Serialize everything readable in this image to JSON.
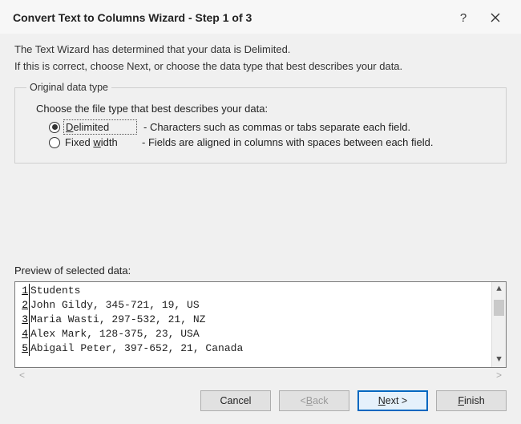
{
  "titlebar": {
    "title": "Convert Text to Columns Wizard - Step 1 of 3"
  },
  "intro": {
    "line1": "The Text Wizard has determined that your data is Delimited.",
    "line2": "If this is correct, choose Next, or choose the data type that best describes your data."
  },
  "group": {
    "legend": "Original data type",
    "prompt": "Choose the file type that best describes your data:",
    "options": {
      "delimited": {
        "pre": "",
        "accel": "D",
        "post": "elimited",
        "desc": "- Characters such as commas or tabs separate each field.",
        "selected": true
      },
      "fixed": {
        "pre": "Fixed ",
        "accel": "w",
        "post": "idth",
        "desc": "- Fields are aligned in columns with spaces between each field.",
        "selected": false
      }
    }
  },
  "preview": {
    "label": "Preview of selected data:",
    "rows": [
      {
        "n": "1",
        "text": "Students"
      },
      {
        "n": "2",
        "text": "John Gildy, 345-721, 19, US"
      },
      {
        "n": "3",
        "text": "Maria Wasti, 297-532, 21, NZ"
      },
      {
        "n": "4",
        "text": "Alex Mark, 128-375, 23, USA"
      },
      {
        "n": "5",
        "text": "Abigail Peter, 397-652, 21, Canada"
      }
    ]
  },
  "buttons": {
    "cancel": {
      "label": "Cancel"
    },
    "back": {
      "pre": "< ",
      "accel": "B",
      "post": "ack"
    },
    "next": {
      "accel": "N",
      "post": "ext >"
    },
    "finish": {
      "accel": "F",
      "post": "inish"
    }
  }
}
